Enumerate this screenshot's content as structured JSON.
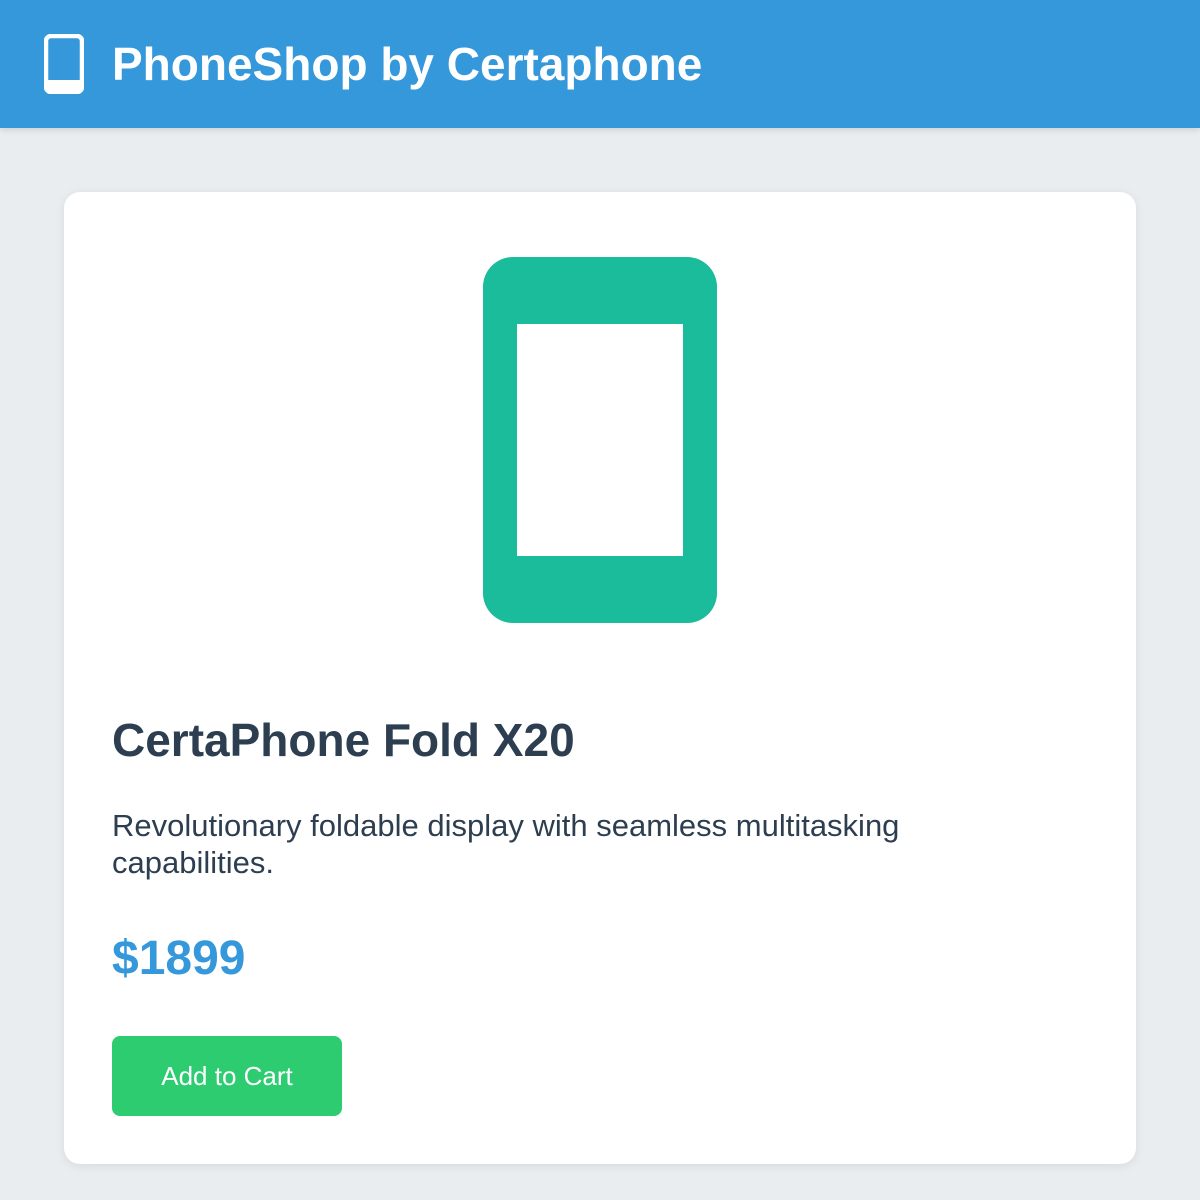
{
  "header": {
    "title": "PhoneShop by Certaphone",
    "icon": "phone-icon",
    "background_color": "#3498db"
  },
  "product": {
    "name": "CertaPhone Fold X20",
    "description": "Revolutionary foldable display with seamless multitasking capabilities.",
    "price": "$1899",
    "image_icon": "phone-illustration",
    "image_color": "#1abc9c",
    "price_color": "#3498db"
  },
  "actions": {
    "add_to_cart_label": "Add to Cart",
    "add_to_cart_color": "#2ecc71"
  }
}
